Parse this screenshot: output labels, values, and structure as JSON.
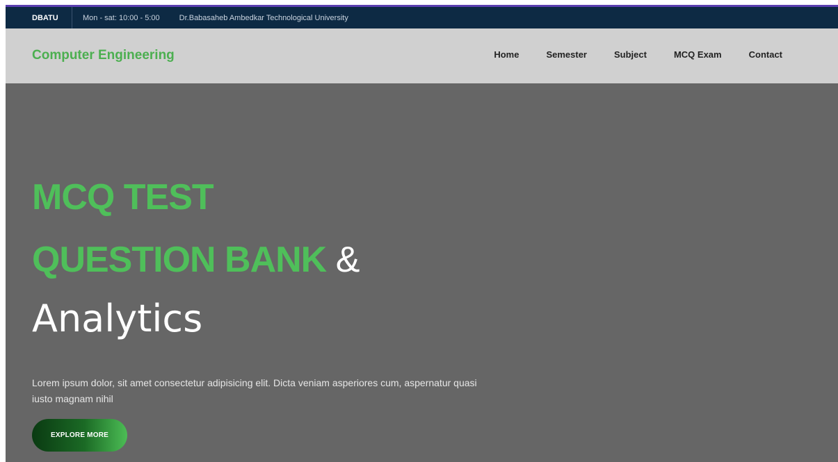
{
  "topbar": {
    "brand": "DBATU",
    "hours": "Mon - sat: 10:00 - 5:00",
    "university": "Dr.Babasaheb Ambedkar Technological University"
  },
  "navbar": {
    "logo": "Computer Engineering",
    "items": [
      {
        "label": "Home"
      },
      {
        "label": "Semester"
      },
      {
        "label": "Subject"
      },
      {
        "label": "MCQ Exam"
      },
      {
        "label": "Contact"
      }
    ]
  },
  "hero": {
    "line1": "MCQ TEST",
    "line2": "QUESTION BANK",
    "ampersand": "&",
    "line3": "Analytics",
    "description": "Lorem ipsum dolor, sit amet consectetur adipisicing elit. Dicta veniam asperiores cum, aspernatur quasi iusto magnam nihil",
    "cta_label": "EXPLORE MORE"
  },
  "colors": {
    "accent_green": "#4fbf5a",
    "topbar_bg": "#0d2a44",
    "navbar_bg": "#d0d0d0",
    "hero_bg": "#666666"
  }
}
